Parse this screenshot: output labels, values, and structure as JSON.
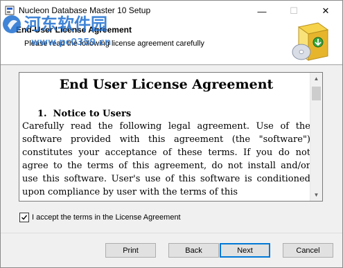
{
  "window": {
    "title": "Nucleon Database Master 10 Setup",
    "controls": {
      "minimize": "—",
      "maximize": "☐",
      "close": "✕"
    }
  },
  "watermark": {
    "line1": "河东软件园",
    "line2": "www.pc0359.cn"
  },
  "header": {
    "title": "End-User License Agreement",
    "subtitle": "Please read the following license agreement carefully"
  },
  "license": {
    "heading": "End User License Agreement",
    "section_number": "1.",
    "section_title": "Notice to Users",
    "lines": [
      "Carefully read the following legal agreement. Use of the",
      "software provided with this agreement (the \"software\")",
      "constitutes your acceptance of these terms. If you do not",
      "agree to the terms of this agreement, do not install and/or",
      "use this software. User's use of this software is conditioned",
      "upon compliance by user with the terms of this"
    ]
  },
  "accept": {
    "label": "I accept the terms in the License Agreement",
    "checked": true
  },
  "buttons": {
    "print": "Print",
    "back": "Back",
    "next": "Next",
    "cancel": "Cancel"
  },
  "colors": {
    "window_bg": "#f0f0f0",
    "header_bg": "#ffffff",
    "watermark": "#1e6fd0",
    "default_button_border": "#0078d7"
  }
}
